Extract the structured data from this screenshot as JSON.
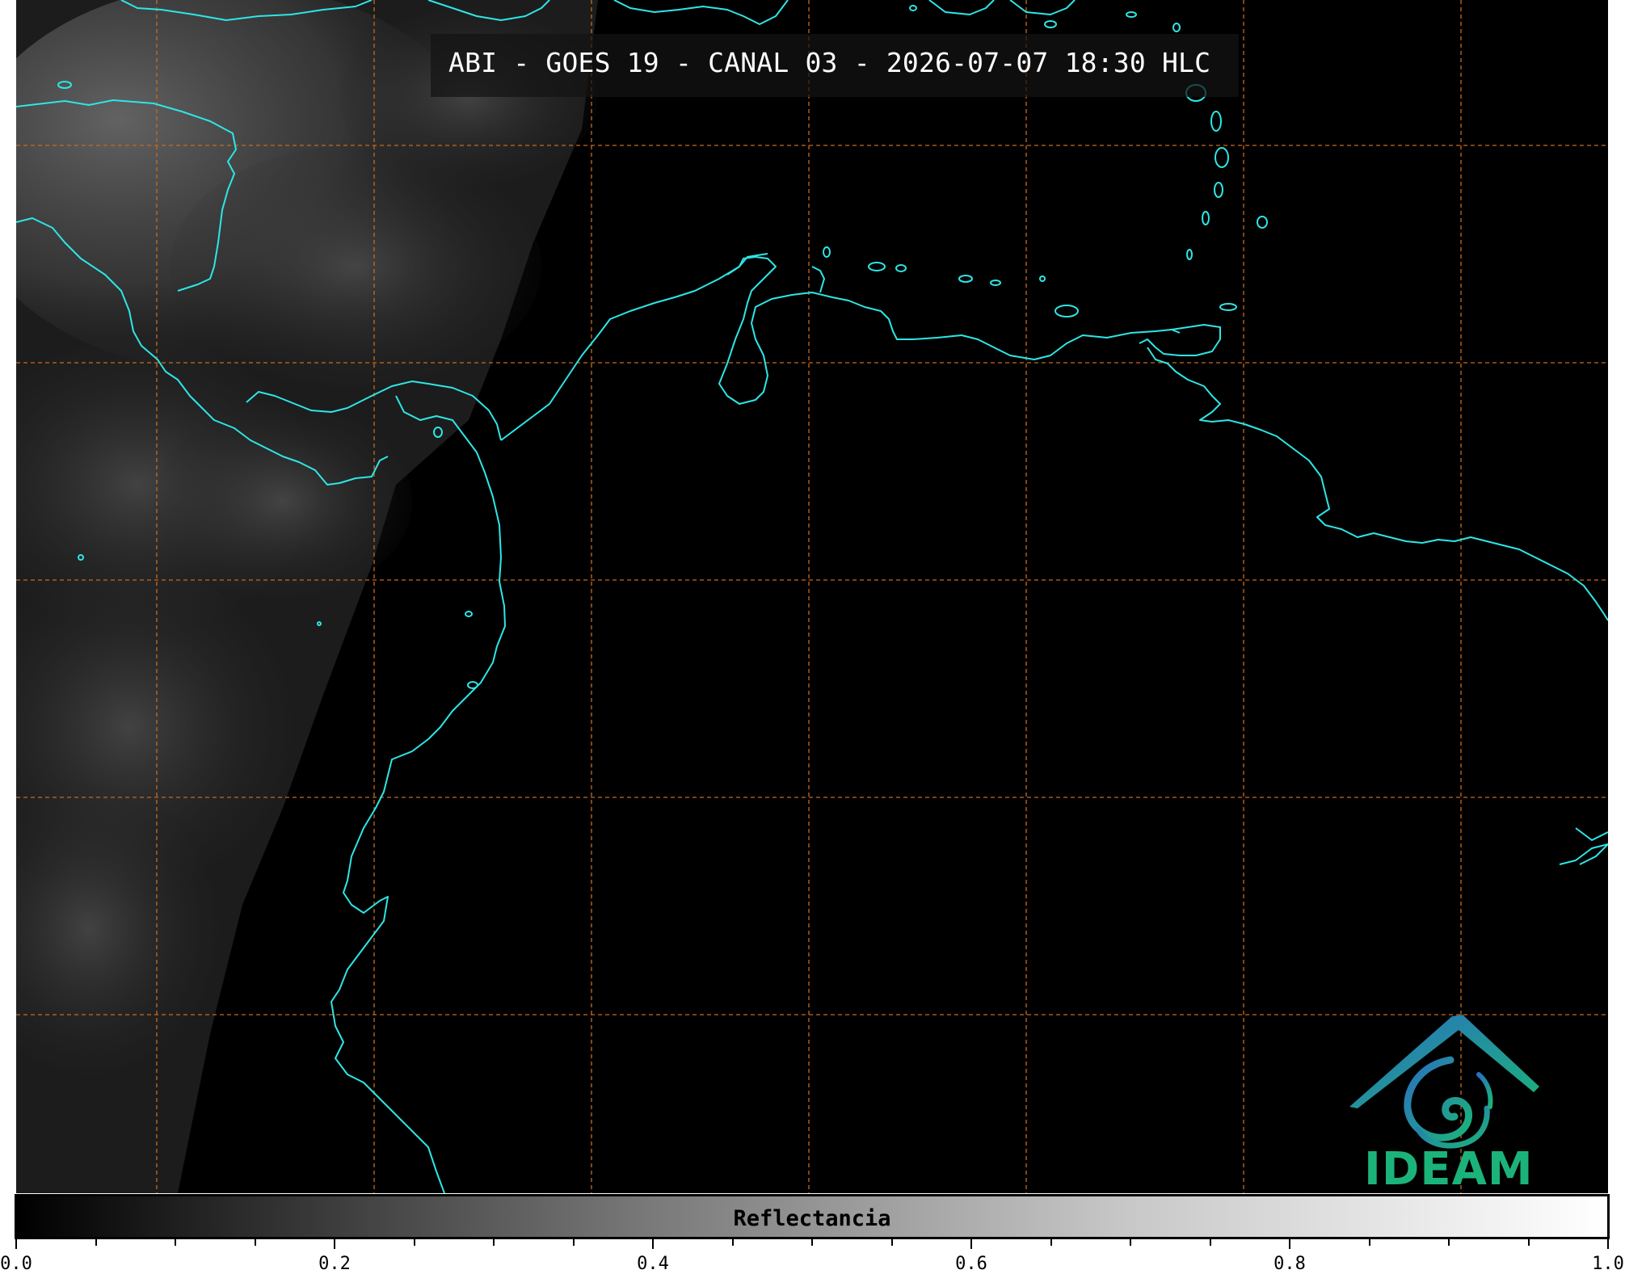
{
  "title": "ABI - GOES 19 - CANAL 03 - 2026-07-07 18:30 HLC",
  "logo": {
    "text": "IDEAM",
    "colors": {
      "text": "#1bb37a",
      "arc_start": "#2a6fc0",
      "arc_end": "#1bb37a"
    }
  },
  "map": {
    "gridline_color": "#c86a1e",
    "coastline_color": "#2ee6e6",
    "background_color": "#000000",
    "cloud_color": "#6a6a6a"
  },
  "colorbar": {
    "label": "Reflectancia",
    "range": [
      0.0,
      1.0
    ],
    "major_ticks": [
      "0.0",
      "0.2",
      "0.4",
      "0.6",
      "0.8",
      "1.0"
    ],
    "minor_tick_step": 0.05,
    "colors": [
      "#000000",
      "#ffffff"
    ]
  }
}
